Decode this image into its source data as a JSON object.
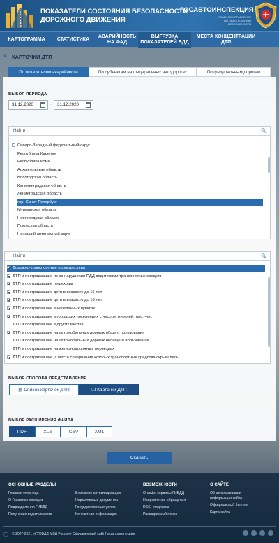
{
  "header": {
    "title_line1": "Показатели состояния безопасности",
    "title_line2": "дорожного движения",
    "gibdd_title": "Госавтоинспекция",
    "gibdd_sub_line1": "Главное управление",
    "gibdd_sub_line2": "по обеспечению",
    "gibdd_sub_line3": "безопасности"
  },
  "nav": [
    {
      "label": "Картограмма"
    },
    {
      "label": "Статистика"
    },
    {
      "label_line1": "Аварийность",
      "label_line2": "на ФАД"
    },
    {
      "label_line1": "Выгрузка",
      "label_line2": "показателей БДД"
    },
    {
      "label_line1": "Места концентрации",
      "label_line2": "ДТП"
    }
  ],
  "page_title": "Карточки ДТП",
  "tabs": [
    {
      "label": "По показателям аварийности",
      "active": true
    },
    {
      "label": "По субъектам на федеральных автодорогах",
      "active": false
    },
    {
      "label": "По федеральным дорогам",
      "active": false
    }
  ],
  "period": {
    "label": "Выбор периода",
    "date_from": "31.12.2020",
    "separator": "-",
    "date_to": "31.12.2020"
  },
  "regions": {
    "search_placeholder": "Найти",
    "items": [
      {
        "label": "Северо-Западный федеральный округ",
        "level": 0,
        "checkbox": true
      },
      {
        "label": "Республика Карелия",
        "level": 1
      },
      {
        "label": "Республика Коми",
        "level": 1
      },
      {
        "label": "Архангельская область",
        "level": 1
      },
      {
        "label": "Вологодская область",
        "level": 1
      },
      {
        "label": "Калининградская область",
        "level": 1
      },
      {
        "label": "Ленинградская область",
        "level": 1
      },
      {
        "label": "гор. Санкт-Петербург",
        "level": 1,
        "selected": true
      },
      {
        "label": "Мурманская область",
        "level": 1
      },
      {
        "label": "Новгородская область",
        "level": 1
      },
      {
        "label": "Псковская область",
        "level": 1
      },
      {
        "label": "Ненецкий автономный округ",
        "level": 1
      }
    ]
  },
  "indicators": {
    "search_placeholder": "Найти",
    "items": [
      {
        "label": "Дорожно-транспортные происшествия",
        "expand": true,
        "selected": true
      },
      {
        "label": "ДТП и пострадавшие из-за нарушения ПДД водителями транспортных средств",
        "expand": true
      },
      {
        "label": "ДТП и пострадавшие пешеходы",
        "expand": true
      },
      {
        "label": "ДТП и пострадавшие дети в возрасте до 16 лет",
        "expand": true
      },
      {
        "label": "ДТП и пострадавшие дети в возрасте до 18 лет",
        "expand": true
      },
      {
        "label": "ДТП и пострадавшие в населенных пунктах",
        "expand": true
      },
      {
        "label": "ДТП и пострадавшие в городских поселениях с числом жителей, тыс. чел.",
        "expand": true
      },
      {
        "label": "ДТП и пострадавшие в других местах",
        "expand": false
      },
      {
        "label": "ДТП и пострадавшие на автомобильных дорогах общего пользования",
        "expand": true
      },
      {
        "label": "ДТП и пострадавшие на автомобильных дорогах необщего пользования",
        "expand": false
      },
      {
        "label": "ДТП и пострадавшие на железнодорожных переездах",
        "expand": false
      },
      {
        "label": "ДТП и пострадавшие, с места совершения которых транспортные средства скрывались",
        "expand": true
      }
    ]
  },
  "view": {
    "label": "Выбор способа представления",
    "options": [
      {
        "label": "Список карточек ДТП",
        "active": false
      },
      {
        "label": "Карточки ДТП",
        "active": true
      }
    ]
  },
  "format": {
    "label": "Выбор расширения файла",
    "options": [
      {
        "label": "PDF",
        "active": true
      },
      {
        "label": "XLS",
        "active": false
      },
      {
        "label": "CSV",
        "active": false
      },
      {
        "label": "XML",
        "active": false
      }
    ]
  },
  "download_label": "Скачать",
  "footer": {
    "col1_head": "Основные разделы",
    "col1": [
      "Главная страница",
      "О Госавтоинспекции",
      "Подразделения ГИБДД",
      "Получение водительского"
    ],
    "col2": [
      "Внимание автовладельцев",
      "Нормативные документы",
      "Государственные услуги",
      "Контактная информация"
    ],
    "col3_head": "Возможности",
    "col3": [
      "Онлайн-сервисы ГИБДД",
      "Направление обращения",
      "RSS - подписка",
      "Расширенный поиск"
    ],
    "col4_head": "О сайте",
    "col4": [
      "Об использовании",
      "информации сайта",
      "Официальный баннер",
      "Карта сайта"
    ],
    "copyright": "© 2007-2021 «ГУОБДД МВД России» Официальный сайт Госавтоинспекции"
  }
}
